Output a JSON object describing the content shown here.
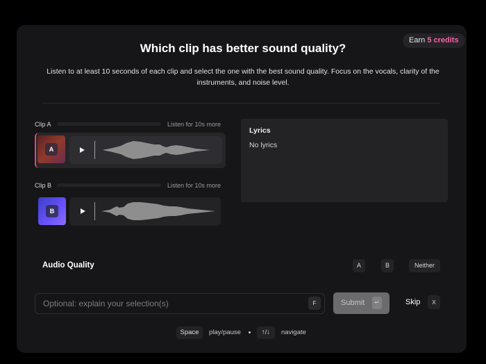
{
  "header": {
    "earn_prefix": "Earn",
    "earn_credits": "5 credits",
    "title": "Which clip has better sound quality?",
    "subtitle": "Listen to at least 10 seconds of each clip and select the one with the best sound quality. Focus on the vocals, clarity of the instruments, and noise level."
  },
  "clips": [
    {
      "label": "Clip A",
      "listen_hint": "Listen for 10s more",
      "badge": "A",
      "progress": 0,
      "active": true
    },
    {
      "label": "Clip B",
      "listen_hint": "Listen for 10s more",
      "badge": "B",
      "progress": 0,
      "active": false
    }
  ],
  "lyrics": {
    "title": "Lyrics",
    "body": "No lyrics"
  },
  "quality": {
    "label": "Audio Quality",
    "options": [
      "A",
      "B",
      "Neither"
    ]
  },
  "explain": {
    "placeholder": "Optional: explain your selection(s)",
    "shortcut": "F"
  },
  "actions": {
    "submit_label": "Submit",
    "submit_shortcut": "↵",
    "skip_label": "Skip",
    "skip_shortcut": "X"
  },
  "hints": {
    "play_key": "Space",
    "play_text": "play/pause",
    "nav_key": "↑/↓",
    "nav_text": "navigate"
  },
  "colors": {
    "accent": "#ff5fa2",
    "active_border": "#e0457e",
    "card_bg": "#161618",
    "page_bg": "#000000"
  }
}
